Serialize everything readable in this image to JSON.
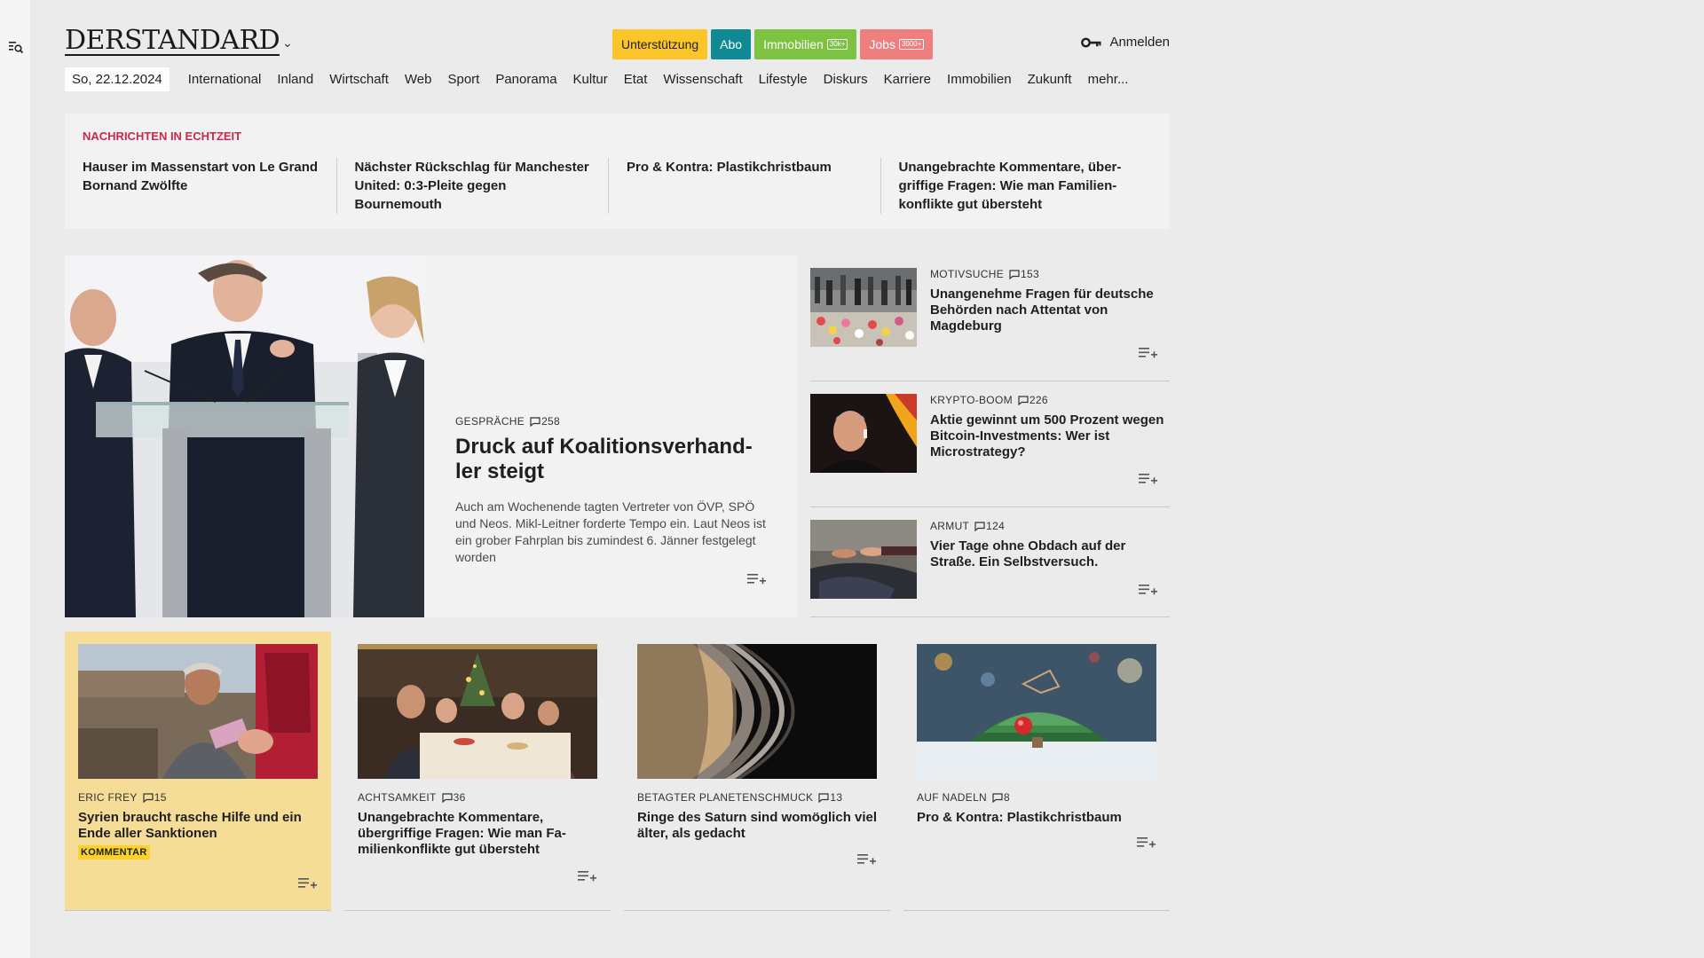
{
  "header": {
    "logo": "DERSTANDARD",
    "chevron": "⌄",
    "pills": [
      {
        "label": "Unterstützung",
        "bg": "#fcc52a",
        "color": "#1f1f1f",
        "tag": ""
      },
      {
        "label": "Abo",
        "bg": "#0f8a94",
        "color": "#ffffff",
        "tag": ""
      },
      {
        "label": "Immobilien",
        "bg": "#7ec242",
        "color": "#ffffff",
        "tag": "30k+"
      },
      {
        "label": "Jobs",
        "bg": "#ef7e7e",
        "color": "#ffffff",
        "tag": "3000+"
      }
    ],
    "login_label": "Anmelden"
  },
  "nav": {
    "date": "So, 22.12.2024",
    "items": [
      "International",
      "Inland",
      "Wirtschaft",
      "Web",
      "Sport",
      "Panorama",
      "Kultur",
      "Etat",
      "Wissenschaft",
      "Lifestyle",
      "Diskurs",
      "Karriere",
      "Immobilien",
      "Zukunft",
      "mehr..."
    ]
  },
  "ticker": {
    "heading": "NACHRICHTEN IN ECHTZEIT",
    "items": [
      "Hauser im Massenstart von Le Grand Bornand Zwölfte",
      "Nächster Rückschlag für Manchester United: 0:3-Pleite gegen Bournemouth",
      "Pro & Kontra: Plastikchristbaum",
      "Unangebrachte Kommentare, über-griffige Fragen: Wie man Familien-konflikte gut übersteht"
    ]
  },
  "hero": {
    "kicker": "GESPRÄCHE",
    "comments": "258",
    "title": "Druck auf Koalitionsverhand-ler steigt",
    "teaser": "Auch am Wochenende tagten Vertreter von ÖVP, SPÖ und Neos. Mikl-Leitner forderte Tempo ein. Laut Neos ist ein grober Fahrplan bis zumindest 6. Jänner festgelegt worden"
  },
  "side": [
    {
      "kicker": "MOTIVSUCHE",
      "comments": "153",
      "title": "Unangenehme Fragen für deutsche Behörden nach Attentat von Magdeburg"
    },
    {
      "kicker": "KRYPTO-BOOM",
      "comments": "226",
      "title": "Aktie gewinnt um 500 Prozent wegen Bitcoin-Investments: Wer ist Microstrategy?"
    },
    {
      "kicker": "ARMUT",
      "comments": "124",
      "title": "Vier Tage ohne Obdach auf der Straße. Ein Selbstversuch."
    }
  ],
  "cards": [
    {
      "kicker": "ERIC FREY",
      "comments": "15",
      "title": "Syrien braucht rasche Hilfe und ein Ende aller Sanktionen",
      "badge": "KOMMENTAR"
    },
    {
      "kicker": "ACHTSAMKEIT",
      "comments": "36",
      "title": "Unangebrachte Kommentare, übergriffige Fragen: Wie man Fa-milienkonflikte gut übersteht"
    },
    {
      "kicker": "BETAGTER PLANETENSCHMUCK",
      "comments": "13",
      "title": "Ringe des Saturn sind womöglich viel älter, als gedacht"
    },
    {
      "kicker": "AUF NADELN",
      "comments": "8",
      "title": "Pro & Kontra: Plastikchristbaum"
    }
  ]
}
